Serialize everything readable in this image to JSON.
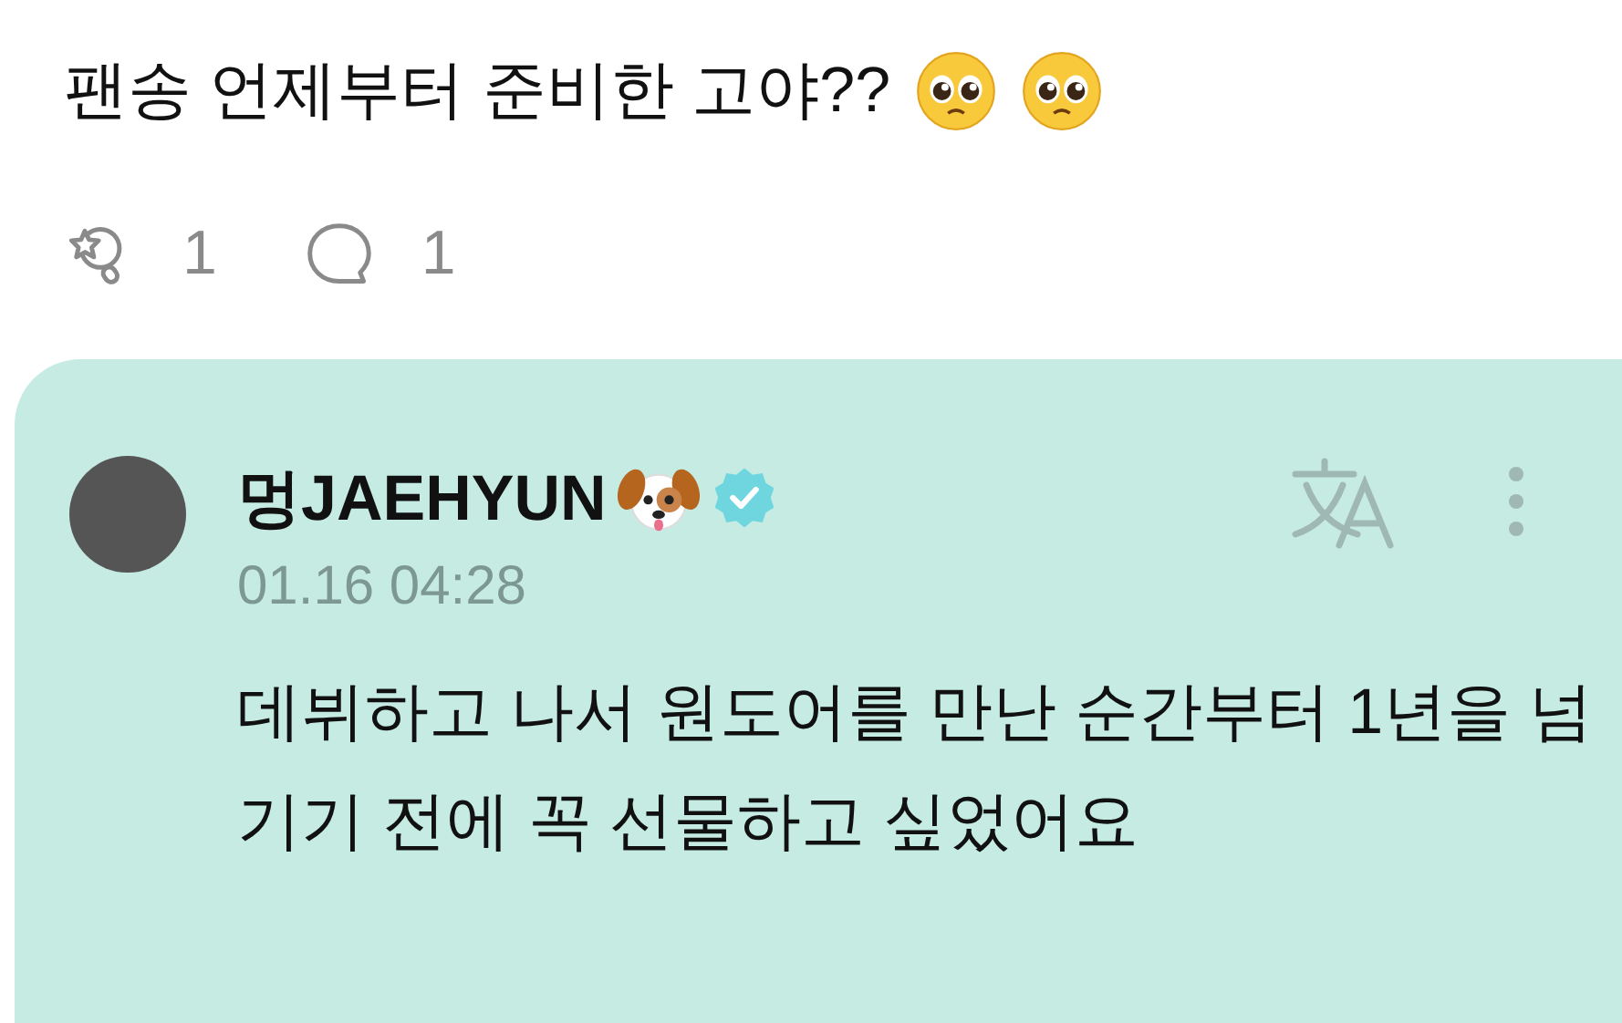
{
  "post": {
    "text": "팬송 언제부터 준비한 고야??",
    "reactions": [
      {
        "kind": "fan",
        "count": "1"
      },
      {
        "kind": "comment",
        "count": "1"
      }
    ]
  },
  "reply": {
    "author": "멍JAEHYUN",
    "verified": true,
    "date": "01.16 04:28",
    "text": "데뷔하고 나서 원도어를 만난 순간부터 1년을 넘기기 전에 꼭 선물하고 싶었어요"
  }
}
